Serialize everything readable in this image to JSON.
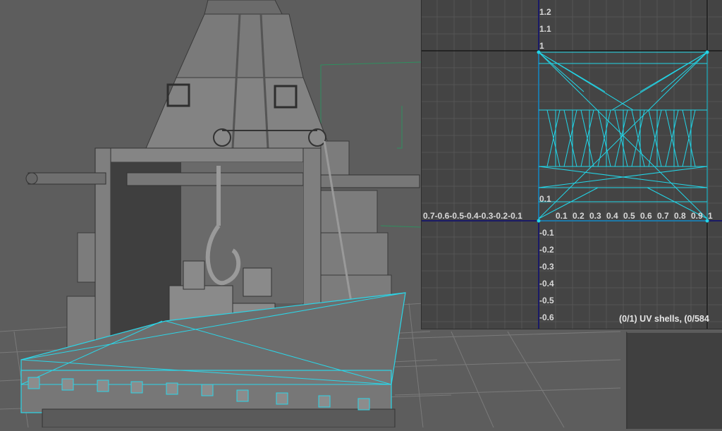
{
  "uv_editor": {
    "v_ticks": [
      "1.2",
      "1.1",
      "1",
      "0.1",
      "-0.1",
      "-0.2",
      "-0.3",
      "-0.4",
      "-0.5",
      "-0.6"
    ],
    "u_axis_text": "0.7-0.6-0.5-0.4-0.3-0.2-0.1",
    "u_axis_pos": [
      "0.1",
      "0.2",
      "0.3",
      "0.4",
      "0.5",
      "0.6",
      "0.7",
      "0.8",
      "0.9",
      "1"
    ],
    "status": "(0/1) UV shells, (0/584"
  },
  "colors": {
    "viewport_bg": "#5d5d5d",
    "uv_panel_bg": "#444444",
    "uv_wire": "#22d6e8",
    "axis": "#1a1a66"
  }
}
